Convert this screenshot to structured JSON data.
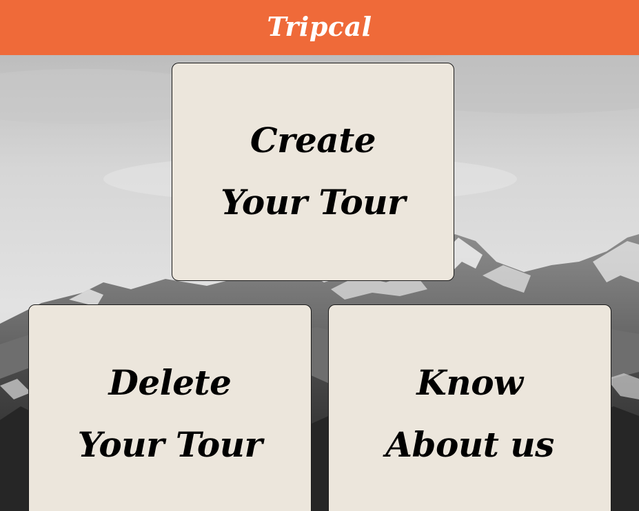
{
  "header": {
    "title": "Tripcal",
    "accent_color": "#ef6a39"
  },
  "background": {
    "description_icon": "mountain-landscape-image"
  },
  "tiles": {
    "create": {
      "label": "Create Your Tour"
    },
    "delete": {
      "label": "Delete Your Tour"
    },
    "about": {
      "label": "Know About us"
    }
  },
  "colors": {
    "tile_bg": "#ece6dc",
    "tile_border": "#1a1a1a",
    "text": "#000000"
  }
}
